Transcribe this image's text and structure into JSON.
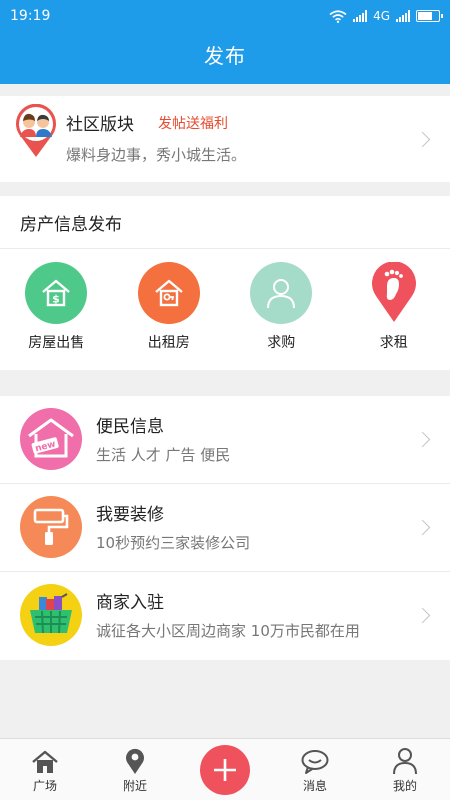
{
  "status": {
    "time": "19:19",
    "network": "4G",
    "battery_level": 0.75
  },
  "header": {
    "title": "发布"
  },
  "community": {
    "title": "社区版块",
    "tag": "发帖送福利",
    "subtitle": "爆料身边事，秀小城生活。"
  },
  "house": {
    "title": "房产信息发布",
    "items": [
      {
        "label": "房屋出售",
        "icon": "house-dollar-icon",
        "color": "#4fc989"
      },
      {
        "label": "出租房",
        "icon": "house-key-icon",
        "color": "#f5703f"
      },
      {
        "label": "求购",
        "icon": "person-icon",
        "color": "#a5dcc9"
      },
      {
        "label": "求租",
        "icon": "footprint-icon",
        "color": "#f0525d"
      }
    ]
  },
  "services": [
    {
      "title": "便民信息",
      "subtitle": "生活 人才 广告 便民",
      "icon": "new-house-icon",
      "color": "#f06ea9",
      "badge": "new"
    },
    {
      "title": "我要装修",
      "subtitle": "10秒预约三家装修公司",
      "icon": "paint-roller-icon",
      "color": "#f58a58"
    },
    {
      "title": "商家入驻",
      "subtitle": "诚征各大小区周边商家 10万市民都在用",
      "icon": "shopping-basket-icon",
      "color": "#f5d114"
    }
  ],
  "tabbar": {
    "items": [
      {
        "label": "广场",
        "icon": "home-icon"
      },
      {
        "label": "附近",
        "icon": "location-pin-icon"
      },
      {
        "label": "",
        "icon": "plus-icon"
      },
      {
        "label": "消息",
        "icon": "chat-icon"
      },
      {
        "label": "我的",
        "icon": "user-icon"
      }
    ]
  }
}
